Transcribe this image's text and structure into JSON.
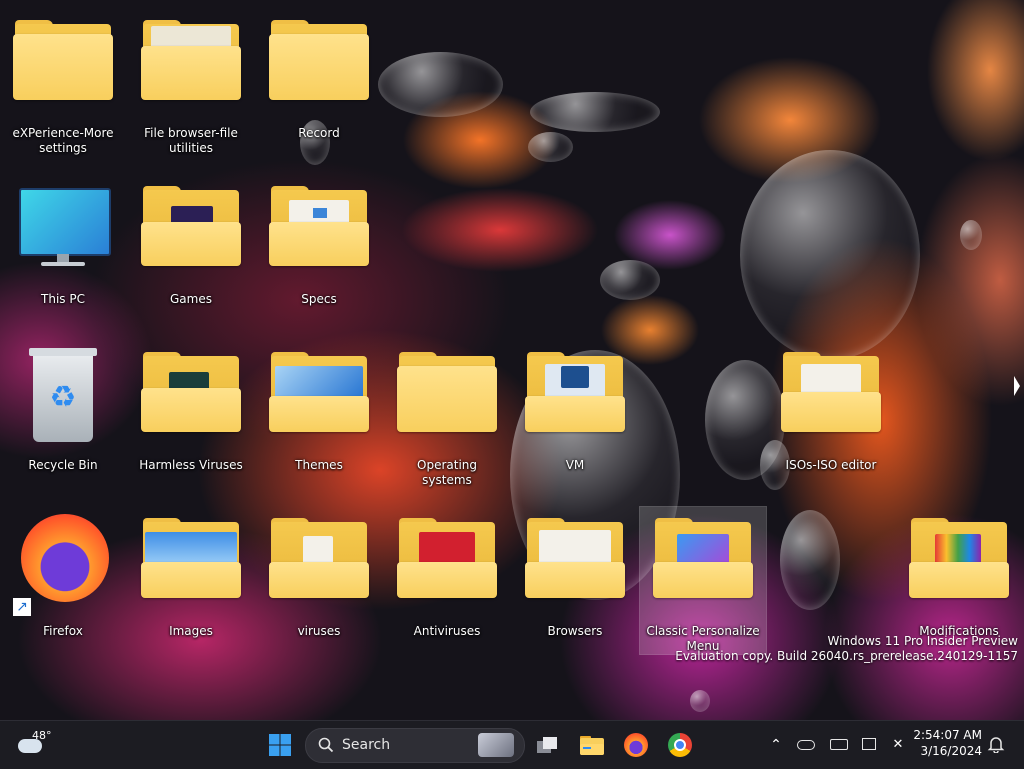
{
  "desktop": {
    "icons": [
      {
        "label": "eXPerience-More settings"
      },
      {
        "label": "File browser-file utilities"
      },
      {
        "label": "Record"
      },
      {
        "label": "This PC"
      },
      {
        "label": "Games"
      },
      {
        "label": "Specs"
      },
      {
        "label": "Recycle Bin"
      },
      {
        "label": "Harmless Viruses"
      },
      {
        "label": "Themes"
      },
      {
        "label": "Operating systems"
      },
      {
        "label": "VM"
      },
      {
        "label": "ISOs-ISO editor"
      },
      {
        "label": "Firefox"
      },
      {
        "label": "Images"
      },
      {
        "label": "viruses"
      },
      {
        "label": "Antiviruses"
      },
      {
        "label": "Browsers"
      },
      {
        "label": "Classic Personalize Menu"
      },
      {
        "label": "Modifications"
      }
    ],
    "watermark": {
      "line1": "Windows 11 Pro Insider Preview",
      "line2": "Evaluation copy. Build 26040.rs_prerelease.240129-1157"
    }
  },
  "taskbar": {
    "weather_temp": "48°",
    "search_label": "Search",
    "apps": [
      "start-icon",
      "task-view-icon",
      "file-explorer-icon",
      "firefox-icon",
      "chrome-icon"
    ],
    "clock": {
      "time": "2:54:07 AM",
      "date": "3/16/2024"
    }
  },
  "colors": {
    "taskbar": "#1c1c22",
    "folder": "#f8cf5d",
    "accent": "#2f8cf0"
  }
}
